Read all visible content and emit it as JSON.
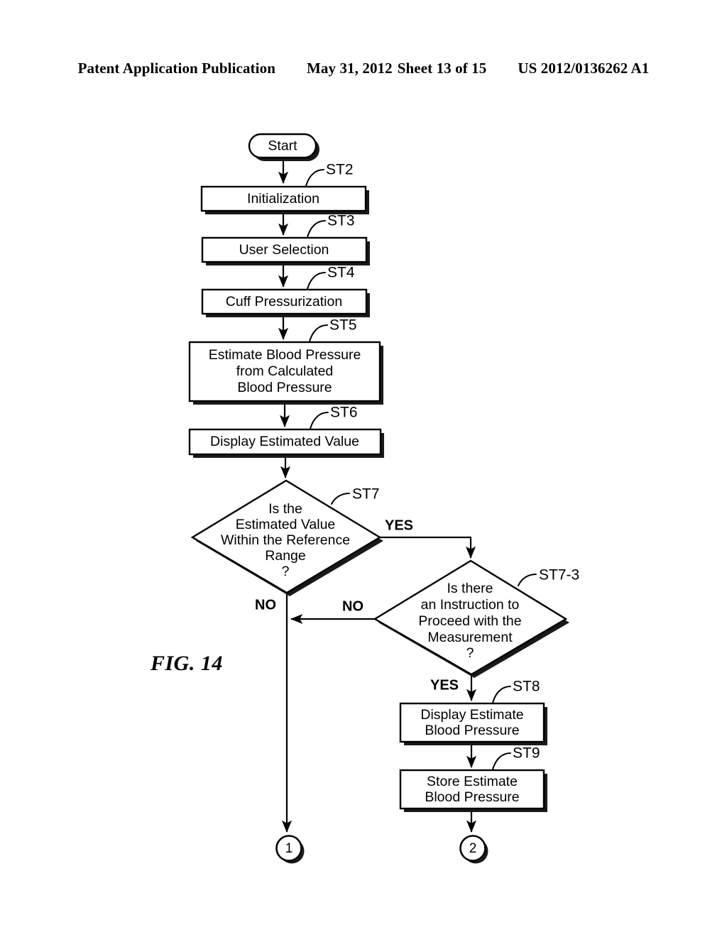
{
  "header": {
    "publication": "Patent Application Publication",
    "date": "May 31, 2012",
    "sheet": "Sheet 13 of 15",
    "number": "US 2012/0136262 A1"
  },
  "figure": {
    "label": "FIG. 14"
  },
  "chart_data": {
    "type": "diagram",
    "title": "FIG. 14",
    "nodes": [
      {
        "id": "start",
        "kind": "terminator",
        "step": "",
        "lines": [
          "Start"
        ]
      },
      {
        "id": "st2",
        "kind": "process",
        "step": "ST2",
        "lines": [
          "Initialization"
        ]
      },
      {
        "id": "st3",
        "kind": "process",
        "step": "ST3",
        "lines": [
          "User Selection"
        ]
      },
      {
        "id": "st4",
        "kind": "process",
        "step": "ST4",
        "lines": [
          "Cuff Pressurization"
        ]
      },
      {
        "id": "st5",
        "kind": "process",
        "step": "ST5",
        "lines": [
          "Estimate Blood Pressure",
          "from Calculated",
          "Blood Pressure"
        ]
      },
      {
        "id": "st6",
        "kind": "process",
        "step": "ST6",
        "lines": [
          "Display Estimated Value"
        ]
      },
      {
        "id": "st7",
        "kind": "decision",
        "step": "ST7",
        "lines": [
          "Is the",
          "Estimated Value",
          "Within the Reference",
          "Range",
          "?"
        ]
      },
      {
        "id": "st7_3",
        "kind": "decision",
        "step": "ST7-3",
        "lines": [
          "Is there",
          "an Instruction to",
          "Proceed with the",
          "Measurement",
          "?"
        ]
      },
      {
        "id": "st8",
        "kind": "process",
        "step": "ST8",
        "lines": [
          "Display Estimate",
          "Blood Pressure"
        ]
      },
      {
        "id": "st9",
        "kind": "process",
        "step": "ST9",
        "lines": [
          "Store Estimate",
          "Blood Pressure"
        ]
      },
      {
        "id": "conn1",
        "kind": "connector",
        "step": "",
        "lines": [
          "1"
        ]
      },
      {
        "id": "conn2",
        "kind": "connector",
        "step": "",
        "lines": [
          "2"
        ]
      }
    ],
    "edges": [
      {
        "from": "start",
        "to": "st2",
        "label": ""
      },
      {
        "from": "st2",
        "to": "st3",
        "label": ""
      },
      {
        "from": "st3",
        "to": "st4",
        "label": ""
      },
      {
        "from": "st4",
        "to": "st5",
        "label": ""
      },
      {
        "from": "st5",
        "to": "st6",
        "label": ""
      },
      {
        "from": "st6",
        "to": "st7",
        "label": ""
      },
      {
        "from": "st7",
        "to": "st7_3",
        "label": "YES"
      },
      {
        "from": "st7",
        "to": "conn1",
        "label": "NO"
      },
      {
        "from": "st7_3",
        "to": "conn1",
        "label": "NO"
      },
      {
        "from": "st7_3",
        "to": "st8",
        "label": "YES"
      },
      {
        "from": "st8",
        "to": "st9",
        "label": ""
      },
      {
        "from": "st9",
        "to": "conn2",
        "label": ""
      }
    ],
    "branch_labels": {
      "st7_yes": "YES",
      "st7_no": "NO",
      "st7_3_no": "NO",
      "st7_3_yes": "YES"
    }
  },
  "nodes": {
    "start": {
      "text": "Start"
    },
    "st2": {
      "step": "ST2",
      "l0": "Initialization"
    },
    "st3": {
      "step": "ST3",
      "l0": "User Selection"
    },
    "st4": {
      "step": "ST4",
      "l0": "Cuff Pressurization"
    },
    "st5": {
      "step": "ST5",
      "l0": "Estimate Blood Pressure",
      "l1": "from Calculated",
      "l2": "Blood Pressure"
    },
    "st6": {
      "step": "ST6",
      "l0": "Display Estimated Value"
    },
    "st7": {
      "step": "ST7",
      "l0": "Is the",
      "l1": "Estimated Value",
      "l2": "Within the Reference",
      "l3": "Range",
      "l4": "?"
    },
    "st7_3": {
      "step": "ST7-3",
      "l0": "Is there",
      "l1": "an Instruction to",
      "l2": "Proceed with the",
      "l3": "Measurement",
      "l4": "?"
    },
    "st8": {
      "step": "ST8",
      "l0": "Display Estimate",
      "l1": "Blood Pressure"
    },
    "st9": {
      "step": "ST9",
      "l0": "Store Estimate",
      "l1": "Blood Pressure"
    },
    "conn1": {
      "text": "1"
    },
    "conn2": {
      "text": "2"
    }
  },
  "branches": {
    "st7_yes": "YES",
    "st7_no": "NO",
    "st7_3_no": "NO",
    "st7_3_yes": "YES"
  },
  "colors": {
    "ink": "#000000",
    "paper": "#ffffff"
  }
}
